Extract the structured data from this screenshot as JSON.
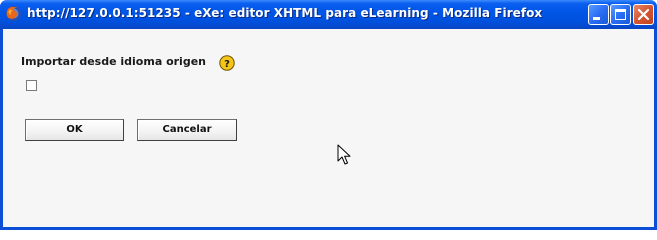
{
  "window": {
    "title": "http://127.0.0.1:51235 - eXe: editor XHTML para eLearning - Mozilla Firefox",
    "icons": {
      "app": "firefox-icon",
      "minimize": "minimize-icon",
      "maximize": "maximize-icon",
      "close": "close-icon"
    }
  },
  "form": {
    "label": "Importar desde idioma origen",
    "help_icon": "help-icon",
    "checkbox_checked": false,
    "ok_label": "OK",
    "cancel_label": "Cancelar"
  },
  "colors": {
    "titlebar": "#0055e5",
    "client_background": "#f6f6f6",
    "close_button": "#d6552f",
    "help_icon": "#f5c518"
  }
}
